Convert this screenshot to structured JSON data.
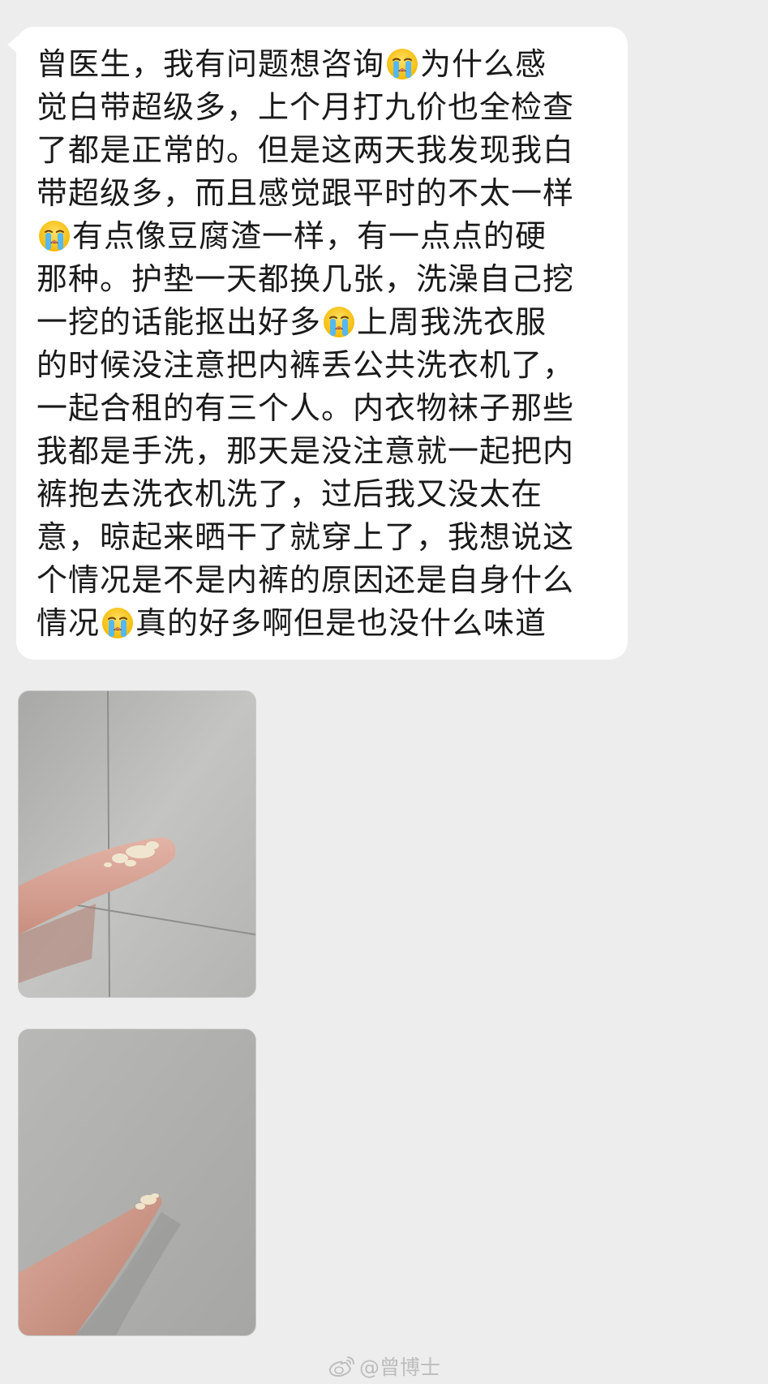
{
  "message": {
    "lines": [
      [
        "曾医生，我有问题想咨询",
        "😭",
        "为什么感"
      ],
      [
        "觉白带超级多，上个月打九价也全检查"
      ],
      [
        "了都是正常的。但是这两天我发现我白"
      ],
      [
        "带超级多，而且感觉跟平时的不太一样"
      ],
      [
        "😭",
        "有点像豆腐渣一样，有一点点的硬"
      ],
      [
        "那种。护垫一天都换几张，洗澡自己挖"
      ],
      [
        "一挖的话能抠出好多",
        "😭",
        "上周我洗衣服"
      ],
      [
        "的时候没注意把内裤丢公共洗衣机了，"
      ],
      [
        "一起合租的有三个人。内衣物袜子那些"
      ],
      [
        "我都是手洗，那天是没注意就一起把内"
      ],
      [
        "裤抱去洗衣机洗了，过后我又没太在"
      ],
      [
        "意，晾起来晒干了就穿上了，我想说这"
      ],
      [
        "个情况是不是内裤的原因还是自身什么"
      ],
      [
        "情况",
        "😭",
        "真的好多啊但是也没什么味道"
      ]
    ],
    "emoji_icon": "loudly-crying-face-icon"
  },
  "photos": [
    {
      "name": "photo-1",
      "description_icon": "photo-thumbnail"
    },
    {
      "name": "photo-2",
      "description_icon": "photo-thumbnail"
    }
  ],
  "watermark": {
    "text": "@曾博士",
    "icon": "weibo-icon"
  },
  "colors": {
    "background": "#ededed",
    "bubble": "#ffffff",
    "text": "#1a1a1a",
    "watermark": "#bdbdbd"
  }
}
